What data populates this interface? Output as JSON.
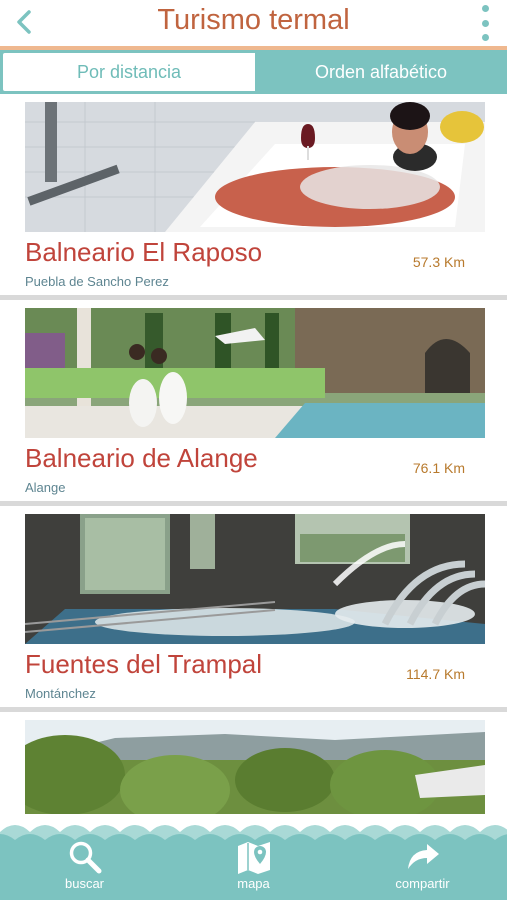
{
  "header": {
    "title": "Turismo termal",
    "back_icon": "chevron-left-icon",
    "menu_icon": "more-vertical-icon"
  },
  "tabs": [
    {
      "label": "Por distancia",
      "active": false
    },
    {
      "label": "Orden alfabético",
      "active": true
    }
  ],
  "items": [
    {
      "name": "Balneario El Raposo",
      "town": "Puebla de Sancho Perez",
      "distance": "57.3 Km",
      "image": "woman-in-spa-bathtub-photo"
    },
    {
      "name": "Balneario de Alange",
      "town": "Alange",
      "distance": "76.1 Km",
      "image": "couple-by-thermal-pool-photo"
    },
    {
      "name": "Fuentes del Trampal",
      "town": "Montánchez",
      "distance": "114.7 Km",
      "image": "indoor-hydro-pool-photo"
    },
    {
      "name": "",
      "town": "",
      "distance": "",
      "image": "forest-landscape-photo"
    }
  ],
  "bottom_nav": [
    {
      "label": "buscar",
      "icon": "search-icon"
    },
    {
      "label": "mapa",
      "icon": "map-pin-icon"
    },
    {
      "label": "compartir",
      "icon": "share-arrow-icon"
    }
  ],
  "colors": {
    "accent_teal": "#7cc3c0",
    "title_orange": "#c0643f",
    "name_red": "#c0443b",
    "distance_gold": "#b87a2d",
    "header_line": "#efb88f"
  }
}
